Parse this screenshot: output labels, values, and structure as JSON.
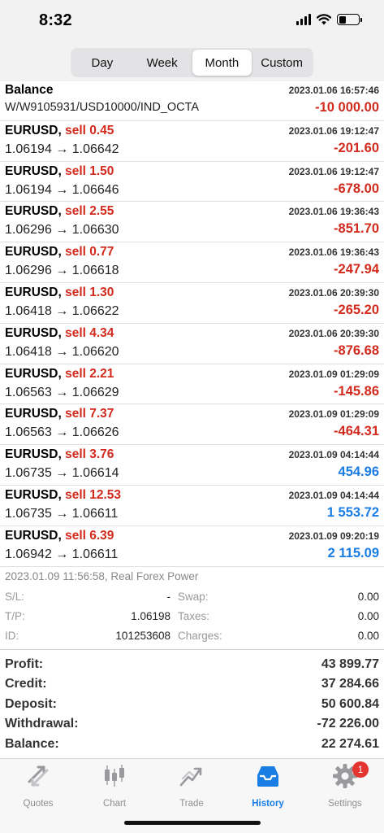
{
  "status_bar": {
    "time": "8:32"
  },
  "segments": [
    {
      "label": "Day",
      "active": false
    },
    {
      "label": "Week",
      "active": false
    },
    {
      "label": "Month",
      "active": true
    },
    {
      "label": "Custom",
      "active": false
    }
  ],
  "balance_entry": {
    "title": "Balance",
    "comment": "W/W9105931/USD10000/IND_OCTA",
    "time": "2023.01.06 16:57:46",
    "amount": "-10 000.00"
  },
  "deals": [
    {
      "symbol": "EURUSD,",
      "dir": "sell 0.45",
      "prices": "1.06194 → 1.06642",
      "time": "2023.01.06 19:12:47",
      "profit": "-201.60",
      "sign": "neg"
    },
    {
      "symbol": "EURUSD,",
      "dir": "sell 1.50",
      "prices": "1.06194 → 1.06646",
      "time": "2023.01.06 19:12:47",
      "profit": "-678.00",
      "sign": "neg"
    },
    {
      "symbol": "EURUSD,",
      "dir": "sell 2.55",
      "prices": "1.06296 → 1.06630",
      "time": "2023.01.06 19:36:43",
      "profit": "-851.70",
      "sign": "neg"
    },
    {
      "symbol": "EURUSD,",
      "dir": "sell 0.77",
      "prices": "1.06296 → 1.06618",
      "time": "2023.01.06 19:36:43",
      "profit": "-247.94",
      "sign": "neg"
    },
    {
      "symbol": "EURUSD,",
      "dir": "sell 1.30",
      "prices": "1.06418 → 1.06622",
      "time": "2023.01.06 20:39:30",
      "profit": "-265.20",
      "sign": "neg"
    },
    {
      "symbol": "EURUSD,",
      "dir": "sell 4.34",
      "prices": "1.06418 → 1.06620",
      "time": "2023.01.06 20:39:30",
      "profit": "-876.68",
      "sign": "neg"
    },
    {
      "symbol": "EURUSD,",
      "dir": "sell 2.21",
      "prices": "1.06563 → 1.06629",
      "time": "2023.01.09 01:29:09",
      "profit": "-145.86",
      "sign": "neg"
    },
    {
      "symbol": "EURUSD,",
      "dir": "sell 7.37",
      "prices": "1.06563 → 1.06626",
      "time": "2023.01.09 01:29:09",
      "profit": "-464.31",
      "sign": "neg"
    },
    {
      "symbol": "EURUSD,",
      "dir": "sell 3.76",
      "prices": "1.06735 → 1.06614",
      "time": "2023.01.09 04:14:44",
      "profit": "454.96",
      "sign": "pos"
    },
    {
      "symbol": "EURUSD,",
      "dir": "sell 12.53",
      "prices": "1.06735 → 1.06611",
      "time": "2023.01.09 04:14:44",
      "profit": "1 553.72",
      "sign": "pos"
    },
    {
      "symbol": "EURUSD,",
      "dir": "sell 6.39",
      "prices": "1.06942 → 1.06611",
      "time": "2023.01.09 09:20:19",
      "profit": "2 115.09",
      "sign": "pos"
    }
  ],
  "detail": {
    "meta": "2023.01.09 11:56:58, Real Forex Power",
    "sl_label": "S/L:",
    "sl_value": "-",
    "tp_label": "T/P:",
    "tp_value": "1.06198",
    "id_label": "ID:",
    "id_value": "101253608",
    "swap_label": "Swap:",
    "swap_value": "0.00",
    "taxes_label": "Taxes:",
    "taxes_value": "0.00",
    "charges_label": "Charges:",
    "charges_value": "0.00"
  },
  "summary": [
    {
      "label": "Profit:",
      "value": "43 899.77"
    },
    {
      "label": "Credit:",
      "value": "37 284.66"
    },
    {
      "label": "Deposit:",
      "value": "50 600.84"
    },
    {
      "label": "Withdrawal:",
      "value": "-72 226.00"
    },
    {
      "label": "Balance:",
      "value": "22 274.61"
    }
  ],
  "tabbar": {
    "quotes": "Quotes",
    "chart": "Chart",
    "trade": "Trade",
    "history": "History",
    "settings": "Settings",
    "settings_badge": "1",
    "active_color": "#1a7de3"
  }
}
